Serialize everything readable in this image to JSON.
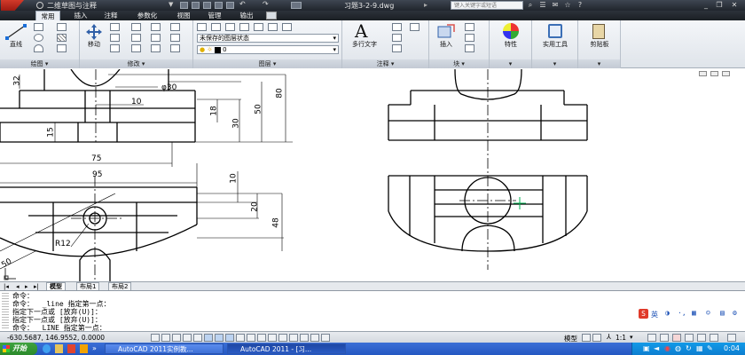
{
  "titlebar": {
    "workspace": "二维草图与注释",
    "filename": "习题3-2-9.dwg",
    "search_placeholder": "键入关键字或短语"
  },
  "ribbon_tabs": [
    "常用",
    "插入",
    "注释",
    "参数化",
    "视图",
    "管理",
    "输出"
  ],
  "ribbon": {
    "draw": {
      "line_label": "直线",
      "panel_label": "绘图"
    },
    "modify": {
      "move_label": "移动",
      "panel_label": "修改"
    },
    "layers": {
      "layer_state": "未保存的图层状态",
      "current_layer": "0",
      "panel_label": "图层"
    },
    "annotation": {
      "mtext_label": "多行文字",
      "panel_label": "注释"
    },
    "block": {
      "insert_label": "插入",
      "panel_label": "块"
    },
    "properties": {
      "label": "特性"
    },
    "utilities": {
      "label": "实用工具"
    },
    "clipboard": {
      "label": "剪贴板"
    }
  },
  "drawing": {
    "dims": {
      "d32": "32",
      "phi30": "φ30",
      "d10a": "10",
      "d80": "80",
      "d18": "18",
      "d50": "50",
      "d30": "30",
      "d15": "15",
      "d75": "75",
      "d95": "95",
      "d10b": "10",
      "d20": "20",
      "d48": "48",
      "r12": "R12",
      "d50b": "50"
    }
  },
  "layout_tabs": [
    "模型",
    "布局1",
    "布局2"
  ],
  "command_lines": [
    "命令：",
    "命令：  _line 指定第一点：",
    "指定下一点或 [放弃(U)]：",
    "指定下一点或 [放弃(U)]：",
    "命令：  LINE 指定第一点："
  ],
  "ime": {
    "label": "英"
  },
  "status": {
    "coords": "-630.5687,  146.9552,  0.0000",
    "model_label": "模型",
    "scale_label": "1:1"
  },
  "taskbar": {
    "start_label": "开始",
    "tasks": [
      "AutoCAD 2011实例教...",
      "AutoCAD 2011 - [习..."
    ],
    "clock": "0:04"
  },
  "colors": {
    "accent": "#2457c2",
    "start_green": "#2b8a2b",
    "ucs_green": "#00b050"
  }
}
